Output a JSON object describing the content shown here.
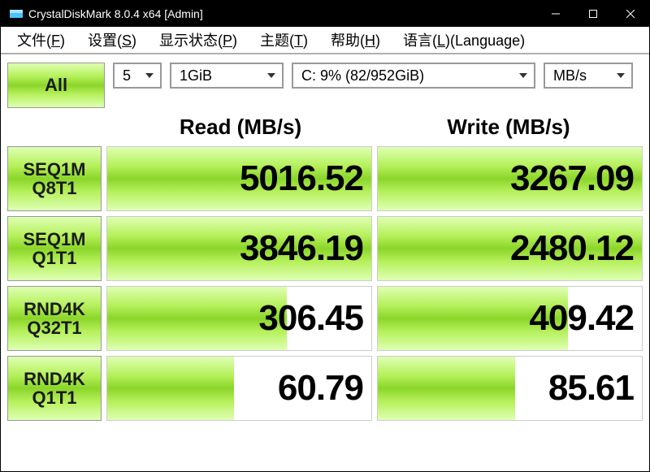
{
  "titlebar": {
    "title": "CrystalDiskMark 8.0.4 x64 [Admin]"
  },
  "menu": [
    {
      "plain": "文件(",
      "underline": "F",
      "tail": ")"
    },
    {
      "plain": "设置(",
      "underline": "S",
      "tail": ")"
    },
    {
      "plain": "显示状态(",
      "underline": "P",
      "tail": ")"
    },
    {
      "plain": "主题(",
      "underline": "T",
      "tail": ")"
    },
    {
      "plain": "帮助(",
      "underline": "H",
      "tail": ")"
    },
    {
      "plain": "语言(",
      "underline": "L",
      "tail": ")(Language)"
    }
  ],
  "controls": {
    "all": "All",
    "runs": "5",
    "size": "1GiB",
    "drive": "C: 9% (82/952GiB)",
    "unit": "MB/s"
  },
  "headers": {
    "read": "Read (MB/s)",
    "write": "Write (MB/s)"
  },
  "tests": [
    {
      "line1": "SEQ1M",
      "line2": "Q8T1",
      "read": "5016.52",
      "rw": "100%",
      "write": "3267.09",
      "ww": "100%"
    },
    {
      "line1": "SEQ1M",
      "line2": "Q1T1",
      "read": "3846.19",
      "rw": "100%",
      "write": "2480.12",
      "ww": "100%"
    },
    {
      "line1": "RND4K",
      "line2": "Q32T1",
      "read": "306.45",
      "rw": "68%",
      "write": "409.42",
      "ww": "72%"
    },
    {
      "line1": "RND4K",
      "line2": "Q1T1",
      "read": "60.79",
      "rw": "48%",
      "write": "85.61",
      "ww": "52%"
    }
  ]
}
